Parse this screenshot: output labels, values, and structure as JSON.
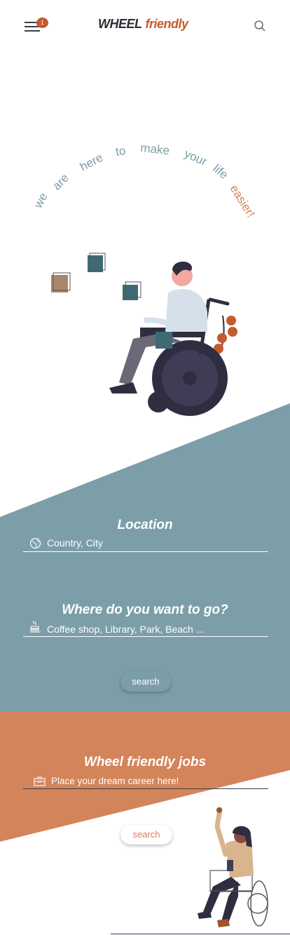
{
  "header": {
    "notification_count": "1",
    "logo_part1": "WHEEL",
    "logo_part2": "friendly"
  },
  "hero": {
    "arc_words": [
      {
        "text": "we",
        "color": "#7c9ea8"
      },
      {
        "text": "are",
        "color": "#7c9ea8"
      },
      {
        "text": "here",
        "color": "#7c9ea8"
      },
      {
        "text": "to",
        "color": "#7c9ea8"
      },
      {
        "text": "make",
        "color": "#7c9ea8"
      },
      {
        "text": "your",
        "color": "#7c9ea8"
      },
      {
        "text": "life",
        "color": "#7c9ea8"
      },
      {
        "text": "easier!",
        "color": "#d4845a"
      }
    ]
  },
  "search_section": {
    "location_title": "Location",
    "location_placeholder": "Country, City",
    "where_title": "Where do you want to go?",
    "where_placeholder": "Coffee shop, Library, Park, Beach ...",
    "search_label": "search"
  },
  "jobs_section": {
    "title": "Wheel friendly jobs",
    "placeholder": "Place your dream career here!",
    "search_label": "search"
  },
  "colors": {
    "teal": "#7c9ea8",
    "orange": "#d4845a",
    "accent_dark_orange": "#c65a2c",
    "dark": "#2f2e41"
  }
}
